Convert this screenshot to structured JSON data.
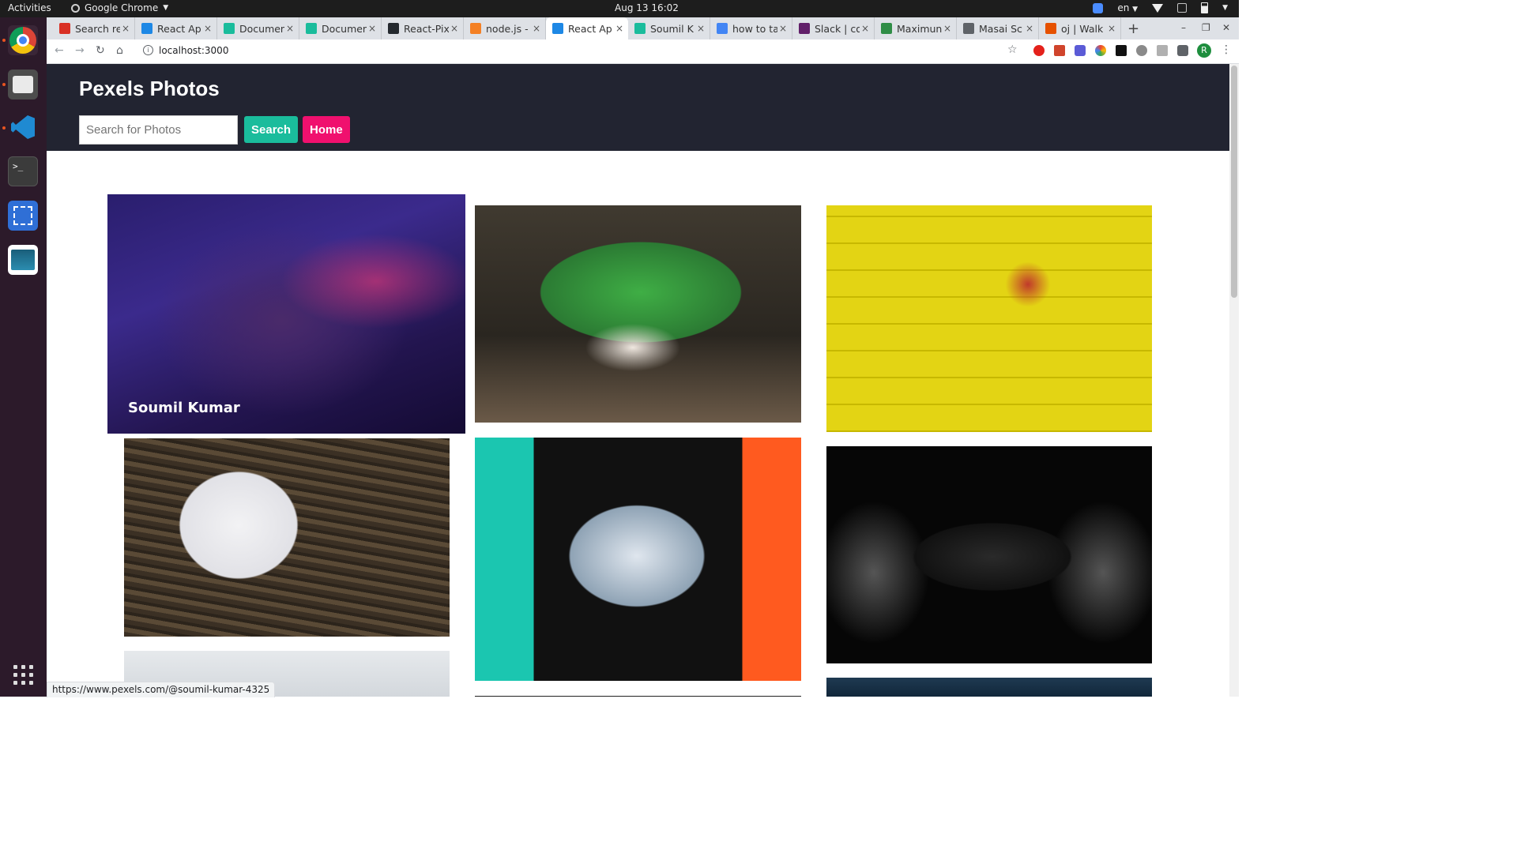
{
  "system": {
    "activities": "Activities",
    "app_name": "Google Chrome",
    "clock": "Aug 13  16:02",
    "language": "en"
  },
  "tabs": [
    {
      "title": "Search re",
      "icon": "gmail-icon",
      "color": "#d93025"
    },
    {
      "title": "React Ap",
      "icon": "react-icon",
      "color": "#1e88e5"
    },
    {
      "title": "Documen",
      "icon": "document-icon",
      "color": "#1abc9c"
    },
    {
      "title": "Documen",
      "icon": "document-icon",
      "color": "#1abc9c"
    },
    {
      "title": "React-Pix",
      "icon": "github-icon",
      "color": "#24292e"
    },
    {
      "title": "node.js - ",
      "icon": "stackoverflow-icon",
      "color": "#f48024"
    },
    {
      "title": "React Ap",
      "icon": "react-icon",
      "color": "#1e88e5",
      "active": true
    },
    {
      "title": "Soumil K",
      "icon": "document-icon",
      "color": "#1abc9c"
    },
    {
      "title": "how to ta",
      "icon": "google-icon",
      "color": "#4285f4"
    },
    {
      "title": "Slack | co",
      "icon": "slack-icon",
      "color": "#611f69"
    },
    {
      "title": "Maximun",
      "icon": "gfg-icon",
      "color": "#2f8d46"
    },
    {
      "title": "Masai Sc",
      "icon": "globe-icon",
      "color": "#5f6368"
    },
    {
      "title": "oj | Walk",
      "icon": "pin-icon",
      "color": "#e65100"
    }
  ],
  "omnibox": {
    "url": "localhost:3000",
    "info_glyph": "i"
  },
  "toolbar_glyphs": {
    "back": "←",
    "forward": "→",
    "reload": "↻",
    "home": "⌂",
    "bookmark": "☆",
    "menu": "⋮",
    "new_tab": "+",
    "tab_close": "×",
    "minimize": "–",
    "maximize": "❐",
    "close": "✕",
    "terminal_prompt": ">_",
    "avatar_initial": "R"
  },
  "site": {
    "title": "Pexels Photos",
    "search_placeholder": "Search for Photos",
    "search_button": "Search",
    "home_button": "Home",
    "accent_search": "#1abc9c",
    "accent_home": "#f0106e",
    "header_bg": "#222431"
  },
  "photos": [
    {
      "caption": "Soumil Kumar",
      "hovered": true
    }
  ],
  "status_bar": {
    "url": "https://www.pexels.com/@soumil-kumar-4325"
  }
}
